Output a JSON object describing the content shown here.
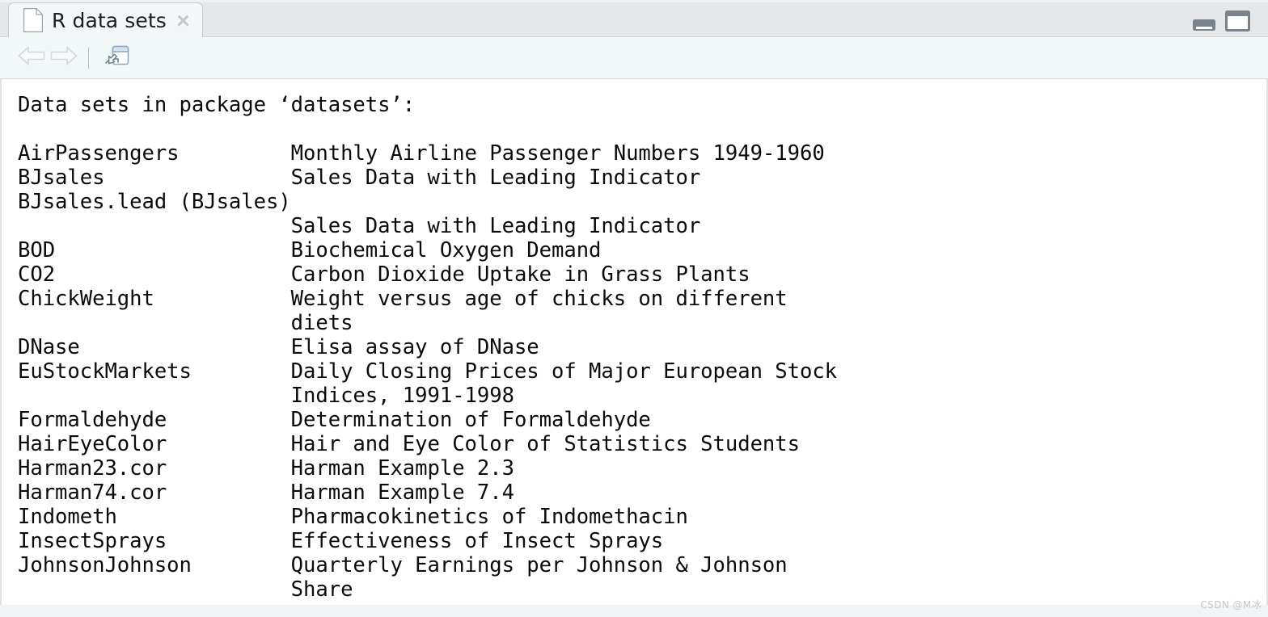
{
  "window": {
    "minimize_label": "Minimize",
    "maximize_label": "Maximize"
  },
  "tab": {
    "title": "R data sets",
    "icon": "page-icon",
    "close_icon": "close-icon"
  },
  "toolbar": {
    "back_label": "Back",
    "forward_label": "Forward",
    "open_in_window_label": "Show in new window",
    "icons": [
      "back-arrow-icon",
      "forward-arrow-icon",
      "open-in-window-icon"
    ]
  },
  "console": {
    "heading": "Data sets in package ‘datasets’:",
    "name_column_width": 22,
    "entries": [
      {
        "name": "AirPassengers",
        "description": "Monthly Airline Passenger Numbers 1949-1960"
      },
      {
        "name": "BJsales",
        "description": "Sales Data with Leading Indicator"
      },
      {
        "name": "BJsales.lead (BJsales)",
        "description": "Sales Data with Leading Indicator"
      },
      {
        "name": "BOD",
        "description": "Biochemical Oxygen Demand"
      },
      {
        "name": "CO2",
        "description": "Carbon Dioxide Uptake in Grass Plants"
      },
      {
        "name": "ChickWeight",
        "description": "Weight versus age of chicks on different diets"
      },
      {
        "name": "DNase",
        "description": "Elisa assay of DNase"
      },
      {
        "name": "EuStockMarkets",
        "description": "Daily Closing Prices of Major European Stock Indices, 1991-1998"
      },
      {
        "name": "Formaldehyde",
        "description": "Determination of Formaldehyde"
      },
      {
        "name": "HairEyeColor",
        "description": "Hair and Eye Color of Statistics Students"
      },
      {
        "name": "Harman23.cor",
        "description": "Harman Example 2.3"
      },
      {
        "name": "Harman74.cor",
        "description": "Harman Example 7.4"
      },
      {
        "name": "Indometh",
        "description": "Pharmacokinetics of Indomethacin"
      },
      {
        "name": "InsectSprays",
        "description": "Effectiveness of Insect Sprays"
      },
      {
        "name": "JohnsonJohnson",
        "description": "Quarterly Earnings per Johnson & Johnson Share"
      }
    ],
    "rendered_text": "Data sets in package ‘datasets’:\n\nAirPassengers         Monthly Airline Passenger Numbers 1949-1960\nBJsales               Sales Data with Leading Indicator\nBJsales.lead (BJsales)\n                      Sales Data with Leading Indicator\nBOD                   Biochemical Oxygen Demand\nCO2                   Carbon Dioxide Uptake in Grass Plants\nChickWeight           Weight versus age of chicks on different\n                      diets\nDNase                 Elisa assay of DNase\nEuStockMarkets        Daily Closing Prices of Major European Stock\n                      Indices, 1991-1998\nFormaldehyde          Determination of Formaldehyde\nHairEyeColor          Hair and Eye Color of Statistics Students\nHarman23.cor          Harman Example 2.3\nHarman74.cor          Harman Example 7.4\nIndometh              Pharmacokinetics of Indomethacin\nInsectSprays          Effectiveness of Insect Sprays\nJohnsonJohnson        Quarterly Earnings per Johnson & Johnson\n                      Share"
  },
  "watermark": {
    "text": "CSDN @M冰"
  },
  "colors": {
    "tabstrip_bg": "#e5e7e9",
    "toolbar_bg": "#f2f7f8",
    "active_tab_bg": "#f3f7f8",
    "content_bg": "#ffffff",
    "text": "#0b0b0b",
    "chrome_gray": "#78838c",
    "disabled_arrow": "#dfe3e6"
  }
}
